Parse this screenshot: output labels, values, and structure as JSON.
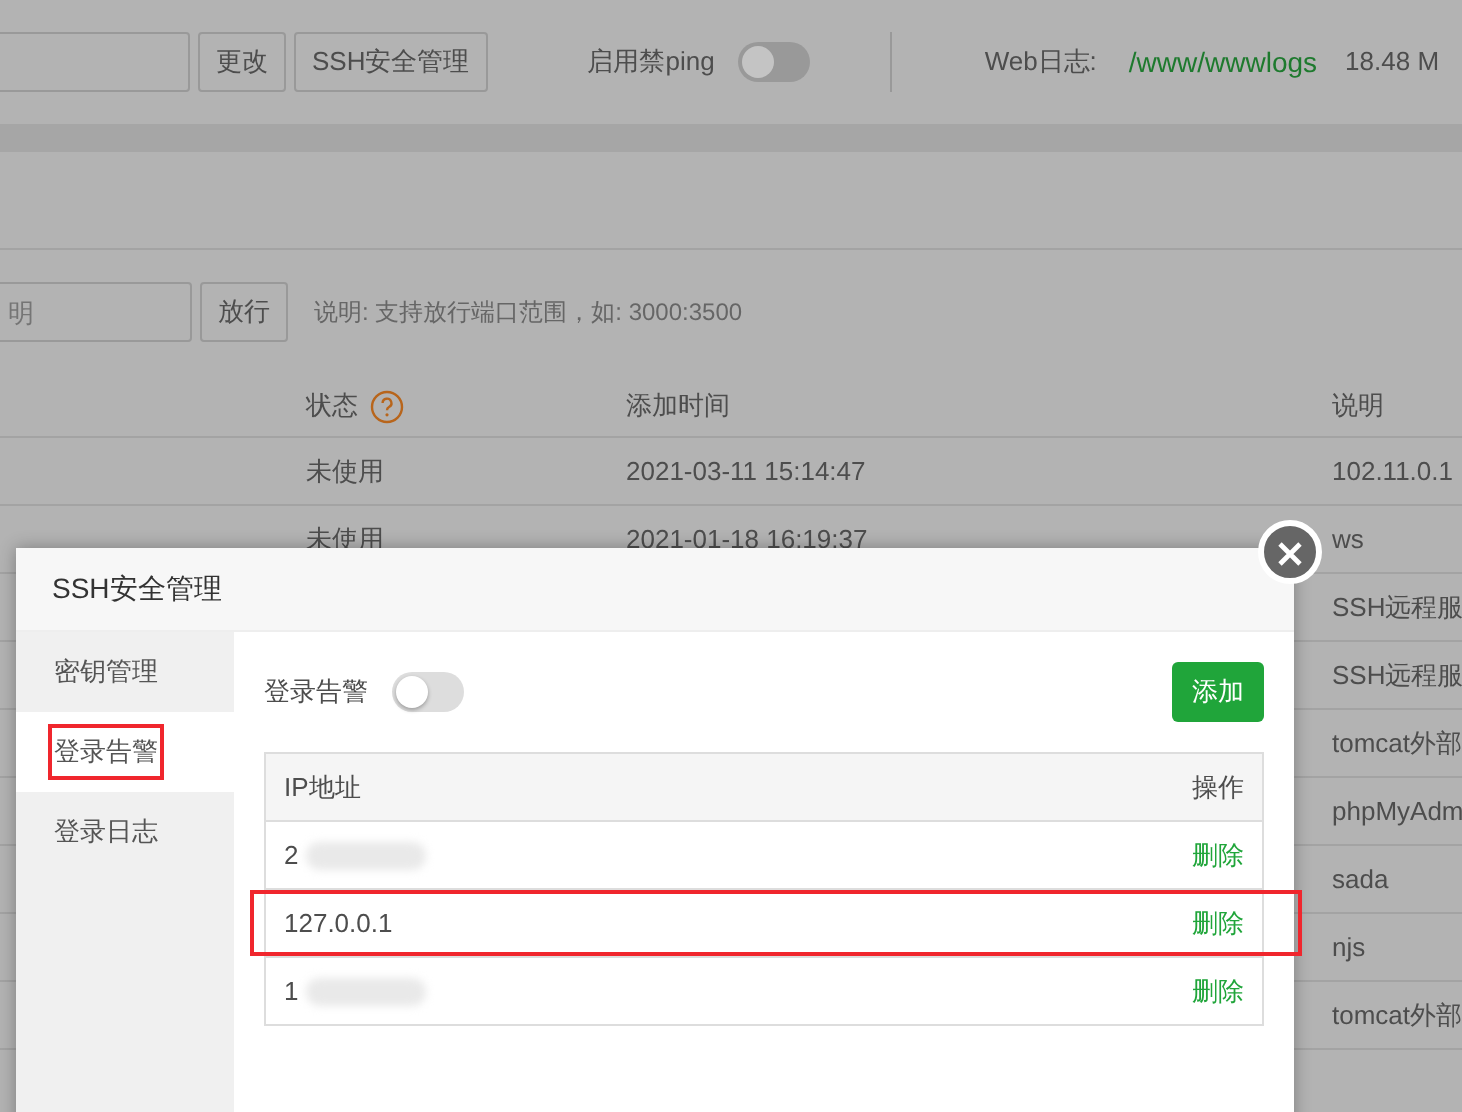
{
  "toolbar": {
    "change_button": "更改",
    "ssh_button": "SSH安全管理",
    "ping_label": "启用禁ping",
    "ping_on": false,
    "weblog_label": "Web日志:",
    "weblog_path": "/www/wwwlogs",
    "weblog_size": "18.48 M"
  },
  "rule_form": {
    "note_placeholder": "明",
    "allow_button": "放行",
    "hint": "说明: 支持放行端口范围，如: 3000:3500"
  },
  "rules_table": {
    "columns": [
      "状态",
      "添加时间",
      "说明"
    ],
    "rows": [
      {
        "status": "未使用",
        "time": "2021-03-11 15:14:47",
        "note": "102.11.0.1"
      },
      {
        "status": "未使用",
        "time": "2021-01-18 16:19:37",
        "note": "ws"
      },
      {
        "note": "SSH远程服"
      },
      {
        "note": "SSH远程服"
      },
      {
        "note": "tomcat外部"
      },
      {
        "note": "phpMyAdm"
      },
      {
        "note": "sada"
      },
      {
        "note": "njs"
      },
      {
        "note": "tomcat外部"
      }
    ]
  },
  "dialog": {
    "title": "SSH安全管理",
    "sidebar": [
      {
        "label": "密钥管理",
        "selected": false,
        "highlighted": false
      },
      {
        "label": "登录告警",
        "selected": true,
        "highlighted": true
      },
      {
        "label": "登录日志",
        "selected": false,
        "highlighted": false
      }
    ],
    "alert_label": "登录告警",
    "alert_on": false,
    "add_button": "添加",
    "columns": [
      "IP地址",
      "操作"
    ],
    "rows": [
      {
        "ip": "2",
        "redacted": true,
        "action": "删除",
        "highlighted": false
      },
      {
        "ip": "127.0.0.1",
        "redacted": false,
        "action": "删除",
        "highlighted": true
      },
      {
        "ip": "1",
        "redacted": true,
        "action": "删除",
        "highlighted": false
      }
    ]
  }
}
